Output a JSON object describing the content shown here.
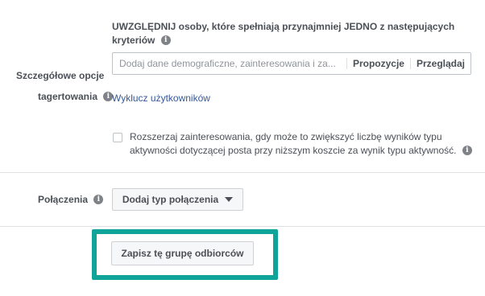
{
  "targeting": {
    "label_line1": "Szczegółowe opcje",
    "label_line2": "tagertowania",
    "include_line1": "UWZGLĘDNIJ osoby, które spełniają przynajmniej JEDNO z następujących",
    "include_line2": "kryteriów",
    "search": {
      "placeholder": "Dodaj dane demograficzne, zainteresowania i za...",
      "value": "",
      "suggestions_label": "Propozycje",
      "browse_label": "Przeglądaj"
    },
    "exclude_link": "Wyklucz użytkowników",
    "expand": {
      "checked": false,
      "line1": "Rozszerzaj zainteresowania, gdy może to zwiększyć liczbę wyników typu",
      "line2": "aktywności dotyczącej posta przy niższym koszcie za wynik typu aktywność."
    }
  },
  "connections": {
    "label": "Połączenia",
    "button_label": "Dodaj typ połączenia"
  },
  "save": {
    "button_label": "Zapisz tę grupę odbiorców",
    "highlight_color": "#10a39a"
  },
  "icons": {
    "info": "info-icon",
    "dropdown": "caret-down-icon"
  }
}
